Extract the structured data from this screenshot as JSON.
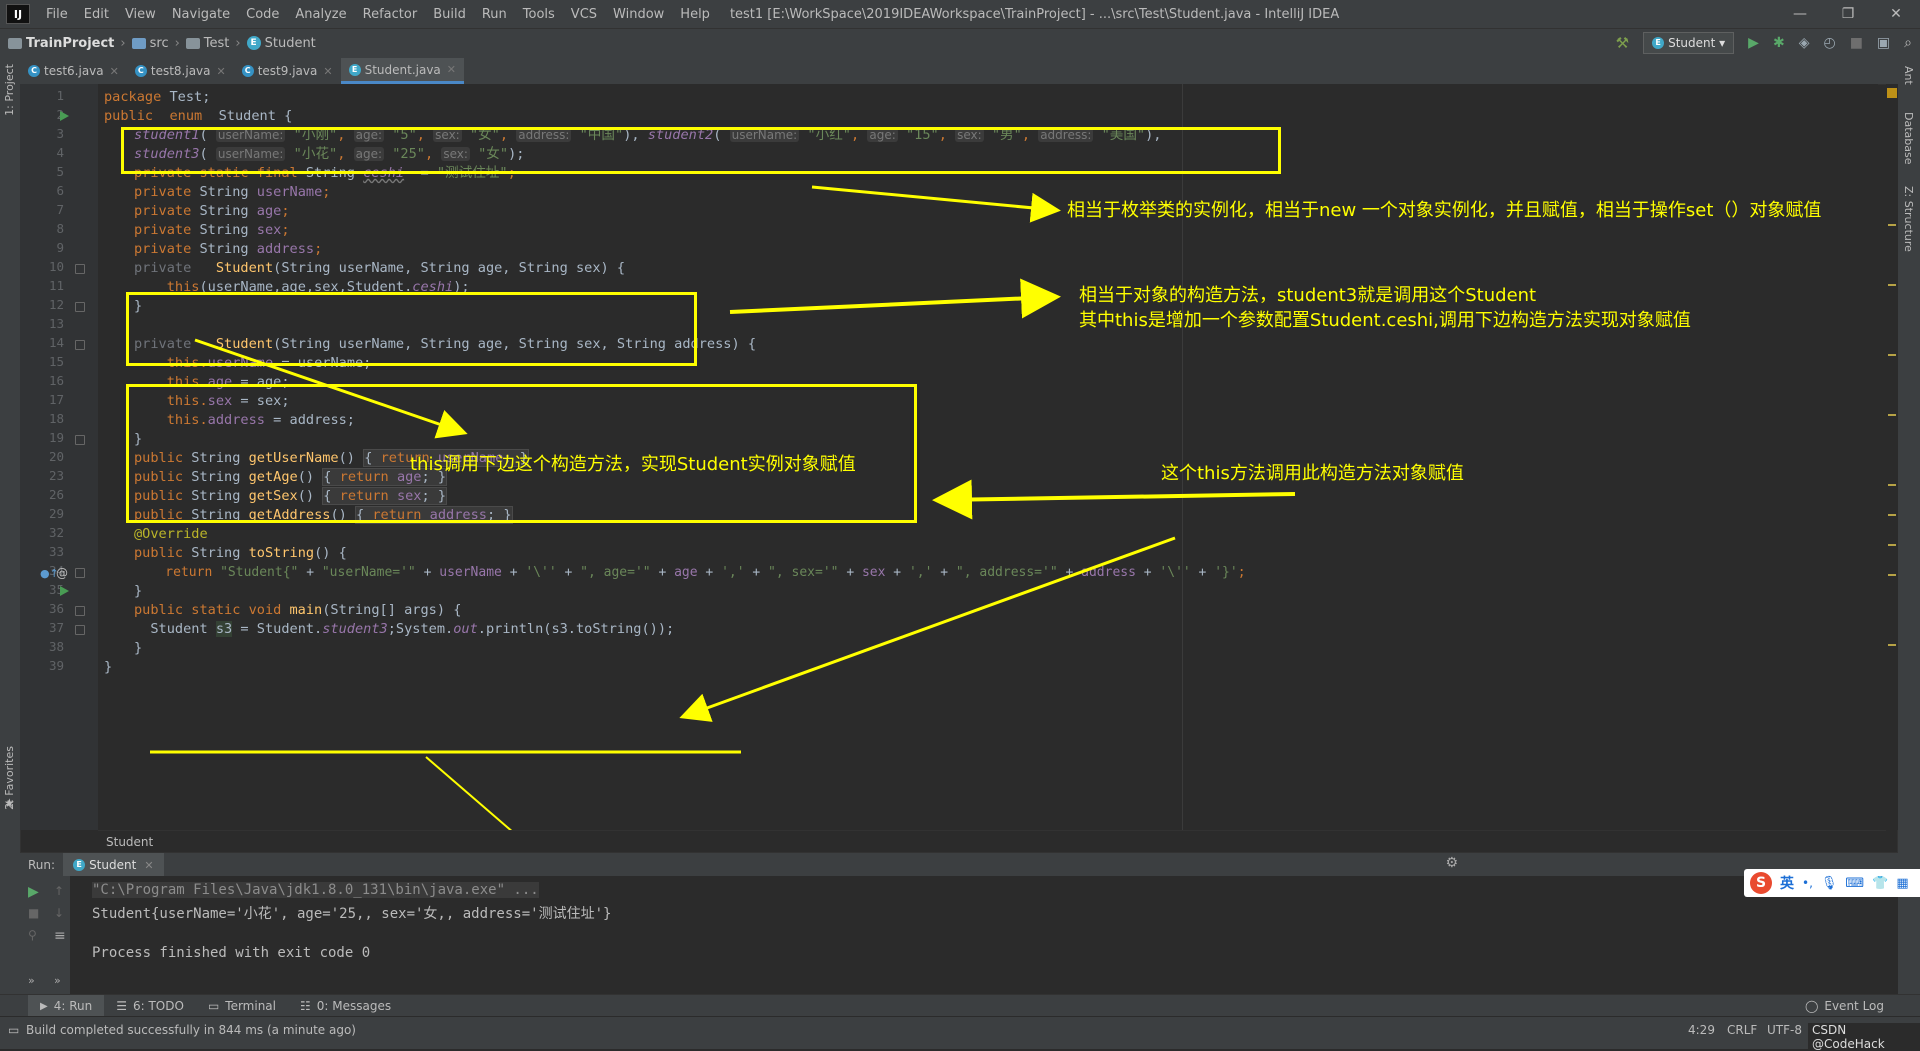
{
  "menubar": {
    "logo": "IJ",
    "items": [
      "File",
      "Edit",
      "View",
      "Navigate",
      "Code",
      "Analyze",
      "Refactor",
      "Build",
      "Run",
      "Tools",
      "VCS",
      "Window",
      "Help"
    ],
    "title": "test1 [E:\\WorkSpace\\2019IDEAWorkspace\\TrainProject] - ...\\src\\Test\\Student.java - IntelliJ IDEA",
    "win_min": "—",
    "win_max": "❐",
    "win_close": "✕"
  },
  "navbar": {
    "project": "TrainProject",
    "src": "src",
    "pkg": "Test",
    "cls": "Student",
    "run_config": "Student ▾"
  },
  "side": {
    "project_tab": "1: Project",
    "favorites_tab": "2: Favorites",
    "ant_tab": "Ant",
    "database_tab": "Database",
    "structure_tab": "Z: Structure"
  },
  "tabs": [
    {
      "label": "test6.java"
    },
    {
      "label": "test8.java"
    },
    {
      "label": "test9.java"
    },
    {
      "label": "Student.java"
    }
  ],
  "line_numbers": [
    "1",
    "2",
    "3",
    "4",
    "5",
    "6",
    "7",
    "8",
    "9",
    "10",
    "11",
    "12",
    "13",
    "14",
    "15",
    "16",
    "17",
    "18",
    "19",
    "20",
    "23",
    "26",
    "29",
    "32",
    "33",
    "34",
    "35",
    "36",
    "37",
    "38",
    "39"
  ],
  "code": {
    "l1a": "package",
    "l1b": " Test;",
    "l2a": "public ",
    "l2b": " enum ",
    "l2c": " Student {",
    "l3": {
      "c1": "student1",
      "p1": "(",
      "h1": "userName:",
      "s1": "\"小刚\"",
      "cm1": ", ",
      "h2": "age:",
      "s2": "\"5\"",
      "cm2": ", ",
      "h3": "sex:",
      "s3": "\"女\"",
      "cm3": ", ",
      "h4": "address:",
      "s4": "\"中国\"",
      "e1": "), ",
      "c2": "student2",
      "p2": "(",
      "h5": "userName:",
      "s5": "\"小红\"",
      "cm5": ", ",
      "h6": "age:",
      "s6": "\"15\"",
      "cm6": ", ",
      "h7": "sex:",
      "s7": "\"男\"",
      "cm7": ", ",
      "h8": "address:",
      "s8": "\"美国\"",
      "e2": "),"
    },
    "l4": {
      "c": "student3",
      "p": "(",
      "h1": "userName:",
      "s1": "\"小花\"",
      "cm1": ", ",
      "h2": "age:",
      "s2": "\"25\"",
      "cm2": ", ",
      "h3": "sex:",
      "s3": "\"女\"",
      "e": ");"
    },
    "l5a": "private static final ",
    "l5b": "String ",
    "l5c": "ceshi",
    "l5d": "  = ",
    "l5e": "\"测试住址\"",
    "l5f": ";",
    "l6a": "private ",
    "l6b": "String ",
    "l6c": "userName",
    "l6d": ";",
    "l7a": "private ",
    "l7b": "String ",
    "l7c": "age",
    "l7d": ";",
    "l8a": "private ",
    "l8b": "String ",
    "l8c": "sex",
    "l8d": ";",
    "l9a": "private ",
    "l9b": "String ",
    "l9c": "address",
    "l9d": ";",
    "l10a": "private  ",
    "l10b": " Student",
    "l10c": "(String userName, String age, String sex) {",
    "l11a": "    this",
    "l11b": "(userName,age,sex,Student.",
    "l11c": "ceshi",
    "l11d": ");",
    "l12": "}",
    "l14a": "private  ",
    "l14b": " Student",
    "l14c": "(String userName, String age, String sex, String address) {",
    "l15a": "    this.",
    "l15b": "userName",
    "l15c": " = userName;",
    "l16a": "    this.",
    "l16b": "age",
    "l16c": " = age;",
    "l17a": "    this.",
    "l17b": "sex",
    "l17c": " = sex;",
    "l18a": "    this.",
    "l18b": "address",
    "l18c": " = address;",
    "l19": "}",
    "l20a": "public ",
    "l20b": "String ",
    "l20c": "getUserName",
    "l20d": "() ",
    "l20e": "{ ",
    "l20f": "return ",
    "l20g": "userName",
    "l20h": "; }",
    "l23a": "public ",
    "l23b": "String ",
    "l23c": "getAge",
    "l23d": "() ",
    "l23e": "{ ",
    "l23f": "return ",
    "l23g": "age",
    "l23h": "; }",
    "l26a": "public ",
    "l26b": "String ",
    "l26c": "getSex",
    "l26d": "() ",
    "l26e": "{ ",
    "l26f": "return ",
    "l26g": "sex",
    "l26h": "; }",
    "l29a": "public ",
    "l29b": "String ",
    "l29c": "getAddress",
    "l29d": "() ",
    "l29e": "{ ",
    "l29f": "return ",
    "l29g": "address",
    "l29h": "; }",
    "l32": "@Override",
    "l33a": "public ",
    "l33b": "String ",
    "l33c": "toString",
    "l33d": "() {",
    "l34a": "    return ",
    "l34b": "\"Student{\" ",
    "l34c": "+ ",
    "l34d": "\"userName='\" ",
    "l34e": "+ ",
    "l34f": "userName",
    "l34g": " + ",
    "l34h": "'\\'' ",
    "l34i": "+ ",
    "l34j": "\", age='\" ",
    "l34k": "+ ",
    "l34l": "age",
    "l34m": " + ",
    "l34n": "','",
    "l34o": " + ",
    "l34p": "\", sex='\" ",
    "l34q": "+ ",
    "l34r": "sex",
    "l34s": " + ",
    "l34t": "','",
    "l34u": " + ",
    "l34v": "\", address='\" ",
    "l34w": "+ ",
    "l34x": "address",
    "l34y": " + ",
    "l34z": "'\\''",
    "l34za": " + ",
    "l34zb": "'}'",
    "l34zc": ";",
    "l35": "}",
    "l36a": "public static void ",
    "l36b": "main",
    "l36c": "(String[] args) {",
    "l37a": "  Student ",
    "l37b": "s3",
    "l37c": " = Student.",
    "l37d": "student3",
    "l37e": ";System.",
    "l37f": "out",
    "l37g": ".println(s3.toString());",
    "l38": "}",
    "l39": "}"
  },
  "annotations": {
    "a1": "相当于枚举类的实例化，相当于new 一个对象实例化，并且赋值，相当于操作set（）对象赋值",
    "a2_line1": "相当于对象的构造方法，student3就是调用这个Student",
    "a2_line2": "其中this是增加一个参数配置Student.ceshi,调用下边构造方法实现对象赋值",
    "a3": "this调用下边这个构造方法，实现Student实例对象赋值",
    "a4": "这个this方法调用此构造方法对象赋值"
  },
  "editor_crumb": "Student",
  "run_panel": {
    "label": "Run:",
    "tab": "Student",
    "lines": [
      "\"C:\\Program Files\\Java\\jdk1.8.0_131\\bin\\java.exe\" ...",
      "Student{userName='小花', age='25,, sex='女,, address='测试住址'}",
      "",
      "Process finished with exit code 0"
    ]
  },
  "bottom_tabs": [
    "4: Run",
    "6: TODO",
    "Terminal",
    "0: Messages"
  ],
  "event_log": "Event Log",
  "status": {
    "message": "Build completed successfully in 844 ms (a minute ago)",
    "position": "4:29",
    "line_sep": "CRLF",
    "encoding": "UTF-8",
    "watermark": "CSDN @CodeHack"
  },
  "ime": {
    "mode": "英"
  },
  "colors": {
    "annotation": "#ffff00",
    "keyword": "#cc7832",
    "string": "#6a8759",
    "field": "#9876aa",
    "method": "#ffc66d"
  }
}
